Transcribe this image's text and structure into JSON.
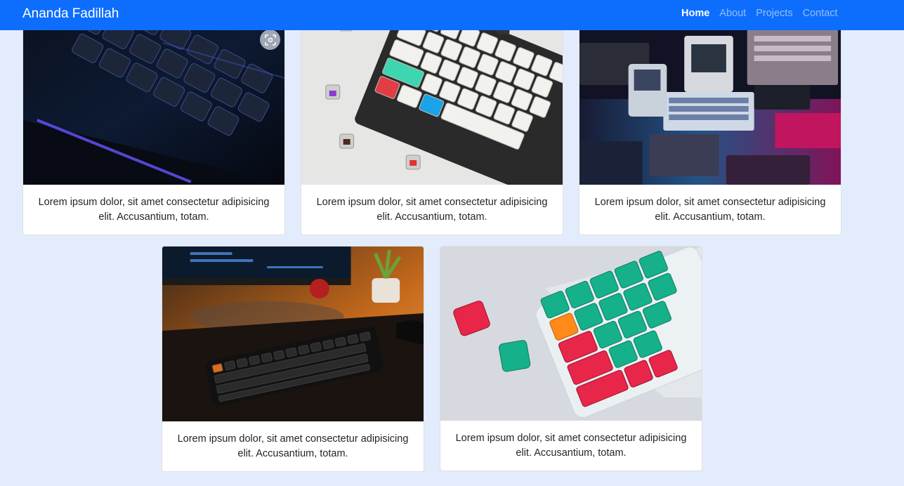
{
  "navbar": {
    "brand": "Ananda Fadillah",
    "links": [
      {
        "label": "Home",
        "active": true
      },
      {
        "label": "About",
        "active": false
      },
      {
        "label": "Projects",
        "active": false
      },
      {
        "label": "Contact",
        "active": false
      }
    ]
  },
  "cards": [
    {
      "image": "dark-rgb-keyboard-photo",
      "text": "Lorem ipsum dolor, sit amet consectetur adipisicing elit. Accusantium, totam."
    },
    {
      "image": "white-mechanical-keyboard-photo",
      "text": "Lorem ipsum dolor, sit amet consectetur adipisicing elit. Accusantium, totam."
    },
    {
      "image": "retro-computers-neon-photo",
      "text": "Lorem ipsum dolor, sit amet consectetur adipisicing elit. Accusantium, totam."
    },
    {
      "image": "desk-keyboard-photo",
      "text": "Lorem ipsum dolor, sit amet consectetur adipisicing elit. Accusantium, totam."
    },
    {
      "image": "colorful-keycaps-keyboard-photo",
      "text": "Lorem ipsum dolor, sit amet consectetur adipisicing elit. Accusantium, totam."
    }
  ],
  "overlay": {
    "icon": "visual-search-icon"
  }
}
